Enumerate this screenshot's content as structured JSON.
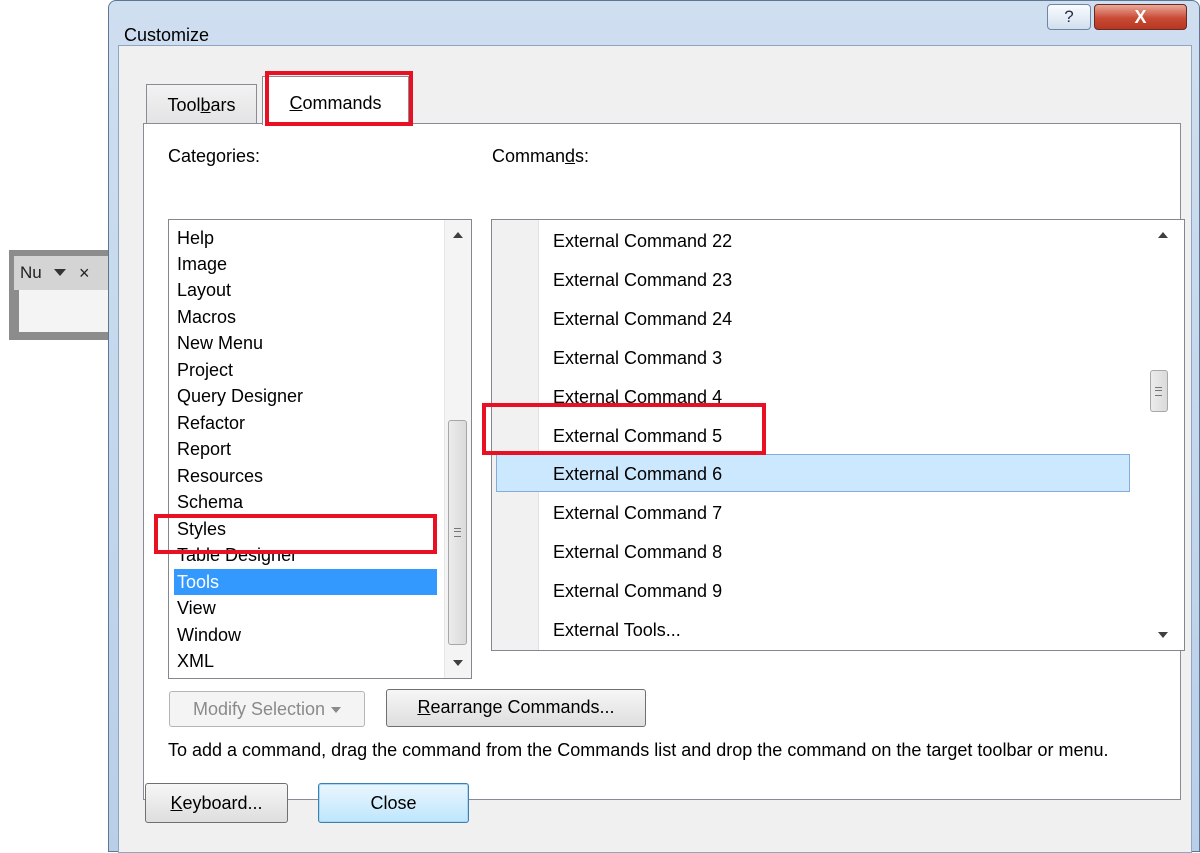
{
  "mini_toolbar": {
    "title": "Nu",
    "close_glyph": "×"
  },
  "dialog": {
    "title": "Customize",
    "help_button": "?",
    "close_button": "X"
  },
  "tabs": [
    {
      "label_pre": "Tool",
      "label_acc": "b",
      "label_post": "ars"
    },
    {
      "label_pre": "",
      "label_acc": "C",
      "label_post": "ommands"
    }
  ],
  "categories_label": {
    "pre": "Cate",
    "acc": "g",
    "post": "ories:"
  },
  "commands_label": {
    "pre": "Comman",
    "acc": "d",
    "post": "s:"
  },
  "categories": [
    "Help",
    "Image",
    "Layout",
    "Macros",
    "New Menu",
    "Project",
    "Query Designer",
    "Refactor",
    "Report",
    "Resources",
    "Schema",
    "Styles",
    "Table Designer",
    "Tools",
    "View",
    "Window",
    "XML"
  ],
  "selected_category": "Tools",
  "commands": [
    "External Command 22",
    "External Command 23",
    "External Command 24",
    "External Command 3",
    "External Command 4",
    "External Command 5",
    "External Command 6",
    "External Command 7",
    "External Command 8",
    "External Command 9",
    "External Tools..."
  ],
  "selected_command": "External Command 6",
  "buttons": {
    "modify_selection": "Modify Selection",
    "rearrange_pre": "",
    "rearrange_acc": "R",
    "rearrange_post": "earrange Commands...",
    "keyboard_pre": "",
    "keyboard_acc": "K",
    "keyboard_post": "eyboard...",
    "close": "Close"
  },
  "hint_text": "To add a command, drag the command from the Commands list and drop the command on the target toolbar or menu.",
  "colors": {
    "selection_blue": "#3399ff",
    "command_selection": "#cce8ff",
    "highlight_red": "#e81123"
  }
}
